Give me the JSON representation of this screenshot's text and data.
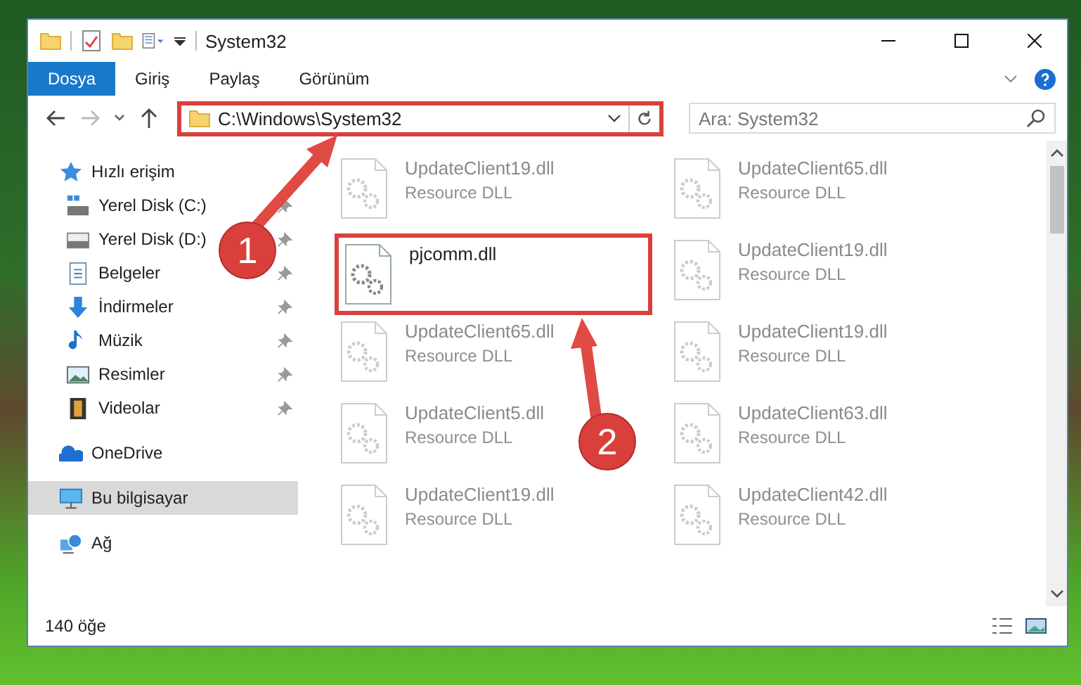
{
  "window": {
    "title": "System32"
  },
  "ribbon": {
    "tabs": [
      {
        "label": "Dosya",
        "selected": true
      },
      {
        "label": "Giriş",
        "selected": false
      },
      {
        "label": "Paylaş",
        "selected": false
      },
      {
        "label": "Görünüm",
        "selected": false
      }
    ]
  },
  "nav": [
    {
      "kind": "back",
      "disabled": false
    },
    {
      "kind": "forward",
      "disabled": true
    },
    {
      "kind": "recent",
      "disabled": false
    },
    {
      "kind": "up",
      "disabled": false
    }
  ],
  "address": {
    "value": "C:\\Windows\\System32",
    "highlighted": true
  },
  "search": {
    "placeholder": "Ara: System32"
  },
  "sidebar": {
    "items": [
      {
        "label": "Hızlı erişim",
        "kind": "star",
        "selected": false,
        "children": [
          {
            "label": "Yerel Disk (C:)",
            "kind": "drive-c",
            "pinned": true,
            "selected": false
          },
          {
            "label": "Yerel Disk (D:)",
            "kind": "drive",
            "pinned": true,
            "selected": false
          },
          {
            "label": "Belgeler",
            "kind": "document",
            "pinned": true,
            "selected": false
          },
          {
            "label": "İndirmeler",
            "kind": "download",
            "pinned": true,
            "selected": false
          },
          {
            "label": "Müzik",
            "kind": "music",
            "pinned": true,
            "selected": false
          },
          {
            "label": "Resimler",
            "kind": "picture",
            "pinned": true,
            "selected": false
          },
          {
            "label": "Videolar",
            "kind": "video",
            "pinned": true,
            "selected": false
          }
        ]
      },
      {
        "label": "OneDrive",
        "kind": "cloud",
        "selected": false
      },
      {
        "label": "Bu bilgisayar",
        "kind": "computer",
        "selected": true
      },
      {
        "label": "Ağ",
        "kind": "network",
        "selected": false
      }
    ]
  },
  "files": [
    {
      "name": "UpdateClient19.dll",
      "type": "Resource DLL",
      "faded": true,
      "highlighted": false
    },
    {
      "name": "UpdateClient65.dll",
      "type": "Resource DLL",
      "faded": true,
      "highlighted": false
    },
    {
      "name": "pjcomm.dll",
      "faded": false,
      "highlighted": true
    },
    {
      "name": "UpdateClient19.dll",
      "type": "Resource DLL",
      "faded": true,
      "highlighted": false
    },
    {
      "name": "UpdateClient65.dll",
      "type": "Resource DLL",
      "faded": true,
      "highlighted": false
    },
    {
      "name": "UpdateClient19.dll",
      "type": "Resource DLL",
      "faded": true,
      "highlighted": false
    },
    {
      "name": "UpdateClient5.dll",
      "type": "Resource DLL",
      "faded": true,
      "highlighted": false
    },
    {
      "name": "UpdateClient63.dll",
      "type": "Resource DLL",
      "faded": true,
      "highlighted": false
    },
    {
      "name": "UpdateClient19.dll",
      "type": "Resource DLL",
      "faded": true,
      "highlighted": false
    },
    {
      "name": "UpdateClient42.dll",
      "type": "Resource DLL",
      "faded": true,
      "highlighted": false
    }
  ],
  "status_bar": {
    "count": "140 öğe"
  },
  "annotations": [
    {
      "label": "1"
    },
    {
      "label": "2"
    }
  ]
}
